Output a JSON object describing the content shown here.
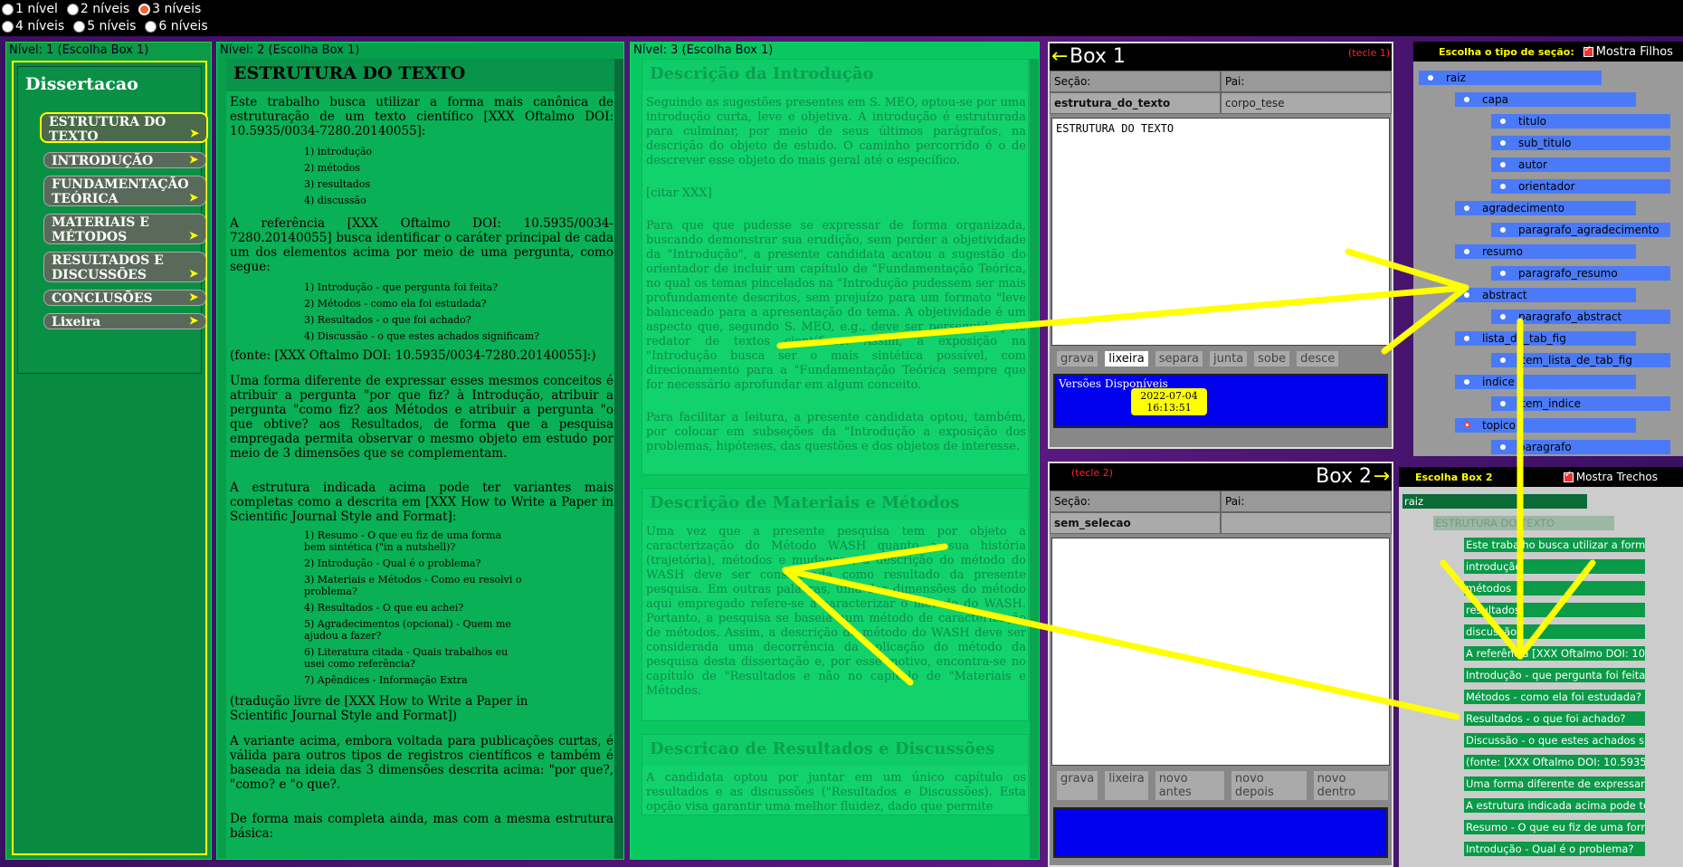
{
  "levels": [
    {
      "label": "1 nível",
      "checked": false
    },
    {
      "label": "2 níveis",
      "checked": false
    },
    {
      "label": "3 níveis",
      "checked": true
    },
    {
      "label": "4 níveis",
      "checked": false
    },
    {
      "label": "5 níveis",
      "checked": false
    },
    {
      "label": "6 níveis",
      "checked": false
    }
  ],
  "panel1": {
    "title": "Nível: 1 (Escolha Box 1)",
    "heading": "Dissertacao",
    "items": [
      "ESTRUTURA DO TEXTO",
      "INTRODUÇÃO",
      "FUNDAMENTAÇÃO TEÓRICA",
      "MATERIAIS E MÉTODOS",
      "RESULTADOS E DISCUSSÕES",
      "CONCLUSÕES",
      "Lixeira"
    ]
  },
  "panel2": {
    "title": "Nível: 2 (Escolha Box 1)",
    "heading": "ESTRUTURA DO TEXTO",
    "p1": "Este trabalho busca utilizar a forma mais canônica de estruturação de um texto científico [XXX Oftalmo DOI: 10.5935/0034-7280.20140055]:",
    "list1": [
      "1) introdução",
      "2) métodos",
      "3) resultados",
      "4) discussão"
    ],
    "p2": "A referência [XXX Oftalmo DOI: 10.5935/0034-7280.20140055] busca identificar o caráter principal de cada um dos elementos acima por meio de uma pergunta, como segue:",
    "list2": [
      "1) Introdução - que pergunta foi feita?",
      "2) Métodos - como ela foi estudada?",
      "3) Resultados - o que foi achado?",
      "4) Discussão - o que estes achados significam?"
    ],
    "p3": "(fonte: [XXX Oftalmo DOI: 10.5935/0034-7280.20140055]:)",
    "p4": "Uma forma diferente de expressar esses mesmos conceitos é atribuir a pergunta \"por que fiz? à Introdução, atribuir a pergunta \"como fiz? aos Métodos e atribuir a pergunta \"o que obtive? aos Resultados, de forma que a pesquisa empregada permita observar o mesmo objeto em estudo por meio de 3 dimensões que se complementam.",
    "p5": "A estrutura indicada acima pode ter variantes mais completas como a descrita em [XXX How to Write a Paper in Scientific Journal Style and Format]:",
    "list3": [
      "1) Resumo - O que eu fiz de uma forma bem sintética (\"in a nutshell)?",
      "2) Introdução - Qual é o problema?",
      "3) Materiais e Métodos - Como eu resolvi o problema?",
      "4) Resultados - O que eu achei?",
      "5) Agradecimentos (opcional) - Quem me ajudou a fazer?",
      "6) Literatura citada - Quais trabalhos eu usei como referência?",
      "7) Apêndices - Informação Extra"
    ],
    "p6": "(tradução livre de [XXX How to Write a Paper in Scientific Journal Style and Format])",
    "p7": "A variante acima, embora voltada para publicações curtas, é válida para outros tipos de registros científicos e também é baseada na ideia das 3 dimensões descrita acima: \"por que?, \"como? e \"o que?.",
    "p8": "De forma mais completa ainda, mas com a mesma estrutura básica:"
  },
  "panel3": {
    "title": "Nível: 3 (Escolha Box 1)",
    "s1_title": "Descrição da Introdução",
    "s1_p1": "Seguindo as sugestões presentes em S. MEO, optou-se por uma introdução curta, leve e objetiva. A introdução é estruturada para culminar, por meio de seus últimos parágrafos, na descrição do objeto de estudo. O caminho percorrido é o de descrever esse objeto do mais geral até o específico.",
    "s1_p2": "[citar XXX]",
    "s1_p3": "Para que que pudesse se expressar de forma organizada, buscando demonstrar sua erudição, sem perder a objetividade da \"Introdução\", a presente candidata acatou a sugestão do orientador de incluir um capítulo de \"Fundamentação Teórica, no qual os temas pincelados na \"Introdução pudessem ser mais profundamente descritos, sem prejuízo para um formato \"leve balanceado para a apresentação do tema. A objetividade é um aspecto que, segundo S. MEO, e.g., deve ser perseguido pelo redator de textos científicos. Assim, a exposição na \"Introdução busca ser o mais sintética possível, com direcionamento para a \"Fundamentação Teórica sempre que for necessário aprofundar em algum conceito.",
    "s1_p4": "Para facilitar a leitura, a presente candidata optou, também, por colocar em subseções da \"Introdução a exposição dos problemas, hipóteses, das questões e dos objetos de interesse.",
    "s2_title": "Descrição de Materiais e Métodos",
    "s2_p1": "Uma vez que a presente pesquisa tem por objeto a caracterização do Método WASH quanto a sua história (trajetória), métodos e mudanças, a descrição do método do WASH deve ser considerada como resultado da presente pesquisa. Em outras palavras, uma das dimensões do método aqui empregado refere-se a caracterizar o método do WASH. Portanto, a pesquisa se baseia num método de caracterização de métodos. Assim, a descrição do método do WASH deve ser considerada uma decorrência da aplicação do método da pesquisa desta dissertação e, por esse motivo, encontra-se no capítulo de \"Resultados e não no capítulo de \"Materiais e Métodos.",
    "s3_title": "Descricao de Resultados e Discussões",
    "s3_p1": "A candidata optou por juntar em um único capítulo os resultados e as discussões (\"Resultados e Discussões). Esta opção visa garantir uma melhor fluidez, dado que permite"
  },
  "box1": {
    "title": "Box 1",
    "left_arrow": "←",
    "hint": "(tecle 1)",
    "secao_label": "Seção:",
    "pai_label": "Pai:",
    "secao_value": "estrutura_do_texto",
    "pai_value": "corpo_tese",
    "text": "ESTRUTURA DO TEXTO",
    "buttons": [
      "grava",
      "lixeira",
      "separa",
      "junta",
      "sobe",
      "desce"
    ],
    "versions_label": "Versões Disponíveis",
    "version_date": "2022-07-04",
    "version_time": "16:13:51"
  },
  "box2": {
    "title": "Box 2",
    "right_arrow": "→",
    "hint": "(tecle 2)",
    "secao_label": "Seção:",
    "pai_label": "Pai:",
    "secao_value": "sem_selecao",
    "pai_value": "",
    "text": "",
    "buttons": [
      "grava",
      "lixeira",
      "novo antes",
      "novo depois",
      "novo dentro"
    ]
  },
  "tree1": {
    "header": "Escolha o tipo de seção:",
    "checkbox_label": "Mostra Filhos",
    "nodes": [
      "raiz",
      "capa",
      "titulo",
      "sub_titulo",
      "autor",
      "orientador",
      "agradecimento",
      "paragrafo_agradecimento",
      "resumo",
      "paragrafo_resumo",
      "abstract",
      "paragrafo_abstract",
      "lista_de_tab_fig",
      "item_lista_de_tab_fig",
      "indice",
      "item_indice",
      "topico",
      "paragrafo"
    ]
  },
  "tree2": {
    "header": "Escolha Box 2",
    "checkbox_label": "Mostra Trechos",
    "nodes": [
      "raiz",
      "ESTRUTURA DO TEXTO",
      "Este trabalho busca utilizar a forma",
      "introdução",
      "métodos",
      "resultados",
      "discussão",
      "A referência [XXX Oftalmo DOI: 10.5",
      "Introdução - que pergunta foi feita?",
      "Métodos - como ela foi estudada?",
      "Resultados - o que foi achado?",
      "Discussão - o que estes achados sign",
      "(fonte: [XXX Oftalmo DOI: 10.5935/0",
      "Uma forma diferente de expressar es",
      "A estrutura indicada acima pode ter",
      "Resumo - O que eu fiz de uma forma",
      "Introdução - Qual é o problema?"
    ]
  },
  "colors": {
    "accent_yellow": "#ffff00",
    "panel_green": "#07a050",
    "box_blue": "#0000ee",
    "tree_blue": "#4a7af8"
  }
}
